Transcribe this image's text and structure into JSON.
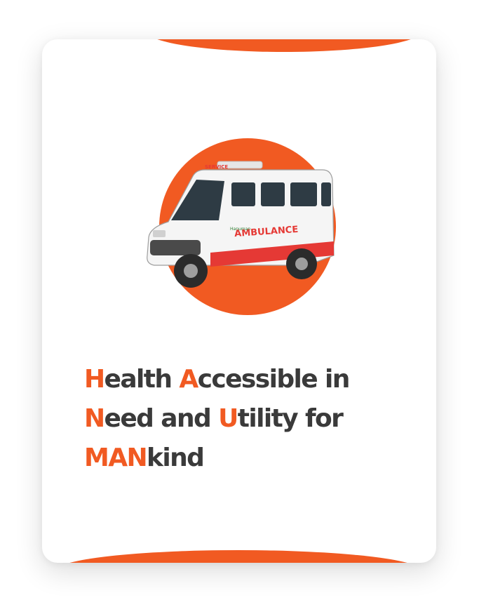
{
  "colors": {
    "accent": "#f15a22",
    "text": "#3a3a3a",
    "card": "#ffffff"
  },
  "hero": {
    "image_icon": "ambulance-van-icon",
    "van_label": "AMBULANCE",
    "van_top_text": "SERVICE",
    "van_brand": "Hanuman"
  },
  "headline": {
    "line1": {
      "a": "H",
      "b": "ealth ",
      "c": "A",
      "d": "ccessible in"
    },
    "line2": {
      "a": "N",
      "b": "eed and ",
      "c": "U",
      "d": "tility for"
    },
    "line3": {
      "a": "MAN",
      "b": "kind"
    }
  }
}
